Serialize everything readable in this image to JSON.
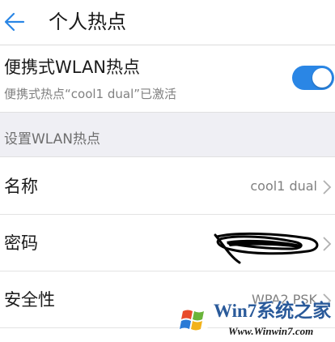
{
  "header": {
    "title": "个人热点",
    "back_icon": "back-arrow-icon"
  },
  "hotspot": {
    "title": "便携式WLAN热点",
    "subtitle": "便携式热点“cool1 dual”已激活",
    "enabled": true
  },
  "section": {
    "label": "设置WLAN热点"
  },
  "settings": [
    {
      "label": "名称",
      "value": "cool1 dual"
    },
    {
      "label": "密码",
      "value": ""
    },
    {
      "label": "安全性",
      "value": "WPA2 PSK"
    }
  ],
  "watermark": {
    "title": "Win7系统之家",
    "url": "Www.Winwin7.com"
  },
  "colors": {
    "accent": "#2a86e5",
    "section_bg": "#efeff4",
    "secondary_text": "#808080"
  }
}
